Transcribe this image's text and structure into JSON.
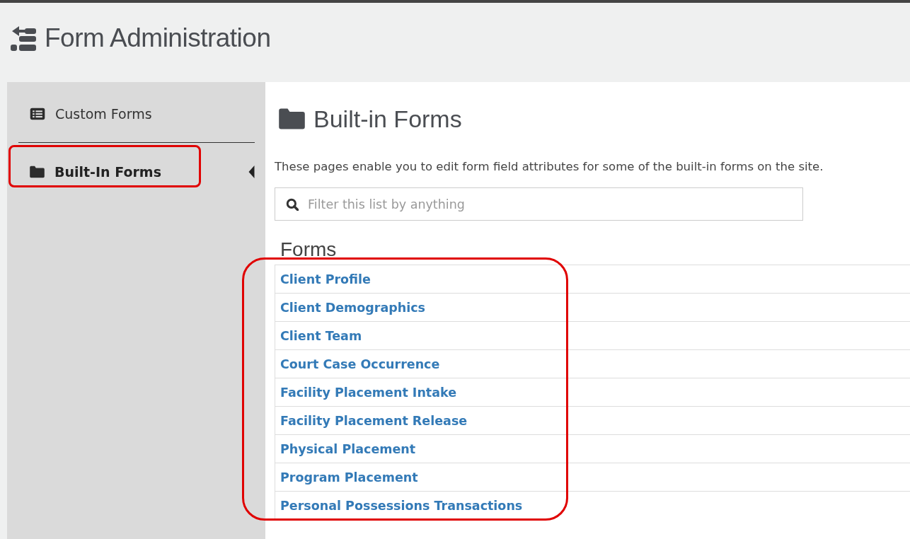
{
  "header": {
    "title": "Form Administration"
  },
  "sidebar": {
    "items": [
      {
        "label": "Custom Forms",
        "selected": false,
        "highlighted": false
      },
      {
        "label": "Built-In Forms",
        "selected": true,
        "highlighted": true
      }
    ]
  },
  "main": {
    "title": "Built-in Forms",
    "description": "These pages enable you to edit form field attributes for some of the built-in forms on the site.",
    "filter": {
      "placeholder": "Filter this list by anything"
    },
    "forms": {
      "heading": "Forms",
      "highlighted": true,
      "items": [
        {
          "label": "Client Profile"
        },
        {
          "label": "Client Demographics"
        },
        {
          "label": "Client Team"
        },
        {
          "label": "Court Case Occurrence"
        },
        {
          "label": "Facility Placement Intake"
        },
        {
          "label": "Facility Placement Release"
        },
        {
          "label": "Physical Placement"
        },
        {
          "label": "Program Placement"
        },
        {
          "label": "Personal Possessions Transactions"
        }
      ]
    }
  }
}
